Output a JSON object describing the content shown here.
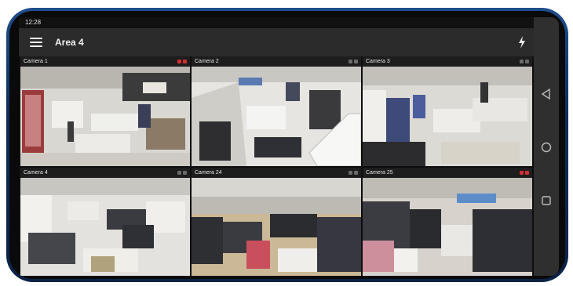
{
  "status_bar": {
    "time": "12:28"
  },
  "app_bar": {
    "title": "Area 4",
    "menu_icon": "menu-icon",
    "action_icon": "flash-icon"
  },
  "cameras": [
    {
      "label": "Camera 1",
      "recording": true
    },
    {
      "label": "Camera 2",
      "recording": false
    },
    {
      "label": "Camera 3",
      "recording": false
    },
    {
      "label": "Camera 4",
      "recording": false
    },
    {
      "label": "Camera 24",
      "recording": false
    },
    {
      "label": "Camera 25",
      "recording": true
    }
  ],
  "navigation": {
    "back_icon": "back-triangle-icon",
    "home_icon": "home-circle-icon",
    "recents_icon": "recents-square-icon"
  },
  "colors": {
    "recording": "#d23030",
    "app_bar": "#2b2b2b",
    "phone_frame": "#1e4e8c"
  }
}
